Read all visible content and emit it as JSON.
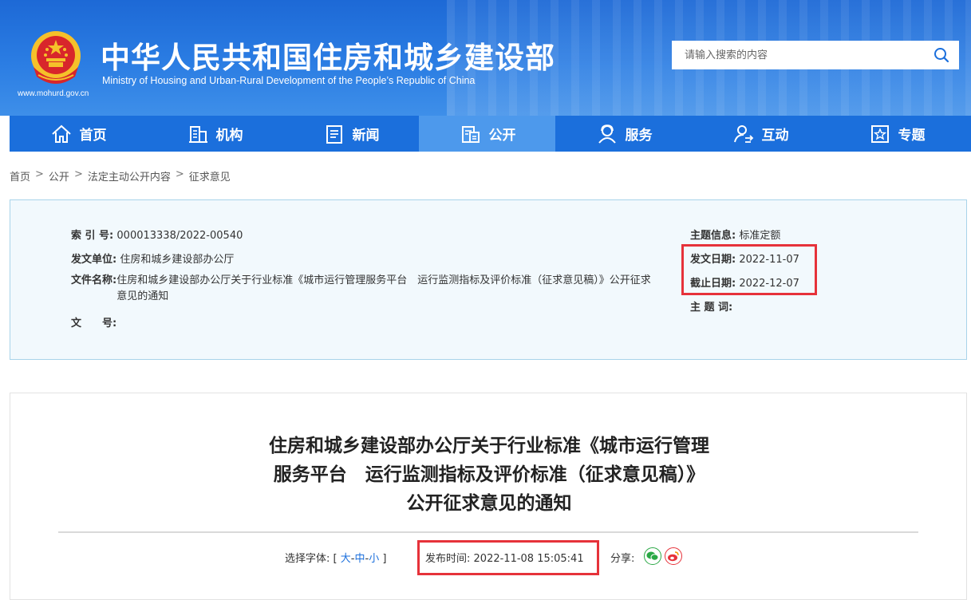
{
  "header": {
    "site_url": "www.mohurd.gov.cn",
    "title_cn": "中华人民共和国住房和城乡建设部",
    "title_en": "Ministry of Housing and Urban-Rural Development of the People’s Republic of China",
    "search_placeholder": "请输入搜索的内容"
  },
  "nav": {
    "items": [
      {
        "label": "首页",
        "icon": "home-icon"
      },
      {
        "label": "机构",
        "icon": "building-icon"
      },
      {
        "label": "新闻",
        "icon": "news-icon"
      },
      {
        "label": "公开",
        "icon": "disclosure-icon"
      },
      {
        "label": "服务",
        "icon": "service-icon"
      },
      {
        "label": "互动",
        "icon": "interact-icon"
      },
      {
        "label": "专题",
        "icon": "star-icon"
      }
    ],
    "active_index": 3
  },
  "breadcrumb": [
    "首页",
    "公开",
    "法定主动公开内容",
    "征求意见"
  ],
  "info": {
    "index_label": "索 引 号:",
    "index_value": "000013338/2022-00540",
    "issuer_label": "发文单位:",
    "issuer_value": "住房和城乡建设部办公厅",
    "filename_label": "文件名称:",
    "filename_value": "住房和城乡建设部办公厅关于行业标准《城市运行管理服务平台　运行监测指标及评价标准（征求意见稿）》公开征求意见的通知",
    "docno_label": "文　　号:",
    "docno_value": "",
    "topic_label": "主题信息:",
    "topic_value": "标准定额",
    "issue_date_label": "发文日期:",
    "issue_date_value": "2022-11-07",
    "deadline_label": "截止日期:",
    "deadline_value": "2022-12-07",
    "keywords_label": "主 题 词:",
    "keywords_value": ""
  },
  "article": {
    "title_line1": "住房和城乡建设部办公厅关于行业标准《城市运行管理",
    "title_line2": "服务平台　运行监测指标及评价标准（征求意见稿）》",
    "title_line3": "公开征求意见的通知",
    "font_label": "选择字体:",
    "font_open": "[",
    "font_large": "大",
    "font_medium": "中",
    "font_small": "小",
    "font_close": "]",
    "font_sep": "-",
    "publish_label": "发布时间:",
    "publish_value": "2022-11-08 15:05:41",
    "share_label": "分享:"
  },
  "colors": {
    "header_blue": "#1d69d6",
    "nav_blue": "#1b6fdc",
    "nav_active": "#4d99ec",
    "highlight_red": "#e6323a",
    "info_bg": "#f2f9fd"
  }
}
